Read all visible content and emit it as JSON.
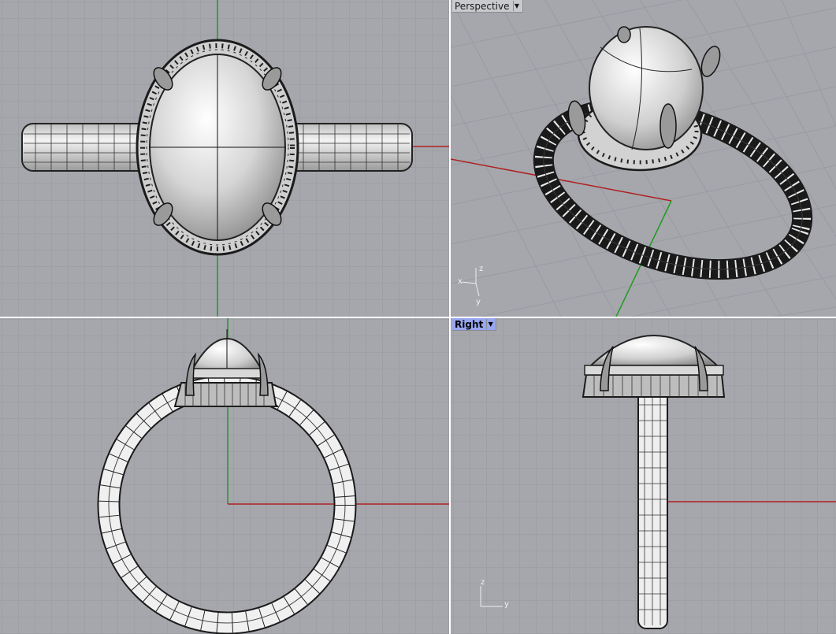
{
  "viewports": {
    "top_left": {
      "label": ""
    },
    "top_right": {
      "label": "Perspective",
      "active": false
    },
    "bottom_left": {
      "label": ""
    },
    "bottom_right": {
      "label": "Right",
      "active": true
    }
  },
  "axis_labels": {
    "x": "x",
    "y": "y",
    "z": "z"
  },
  "colors": {
    "viewport_bg": "#a5a7ad",
    "grid_minor": "#9b9da3",
    "grid_major": "#8d8f95",
    "x_axis": "#b02020",
    "y_axis": "#1f9b1f",
    "active_tab": "#98a7f0",
    "metal": "#d8d8d8"
  },
  "icons": {
    "dropdown": "chevron-down-icon"
  }
}
